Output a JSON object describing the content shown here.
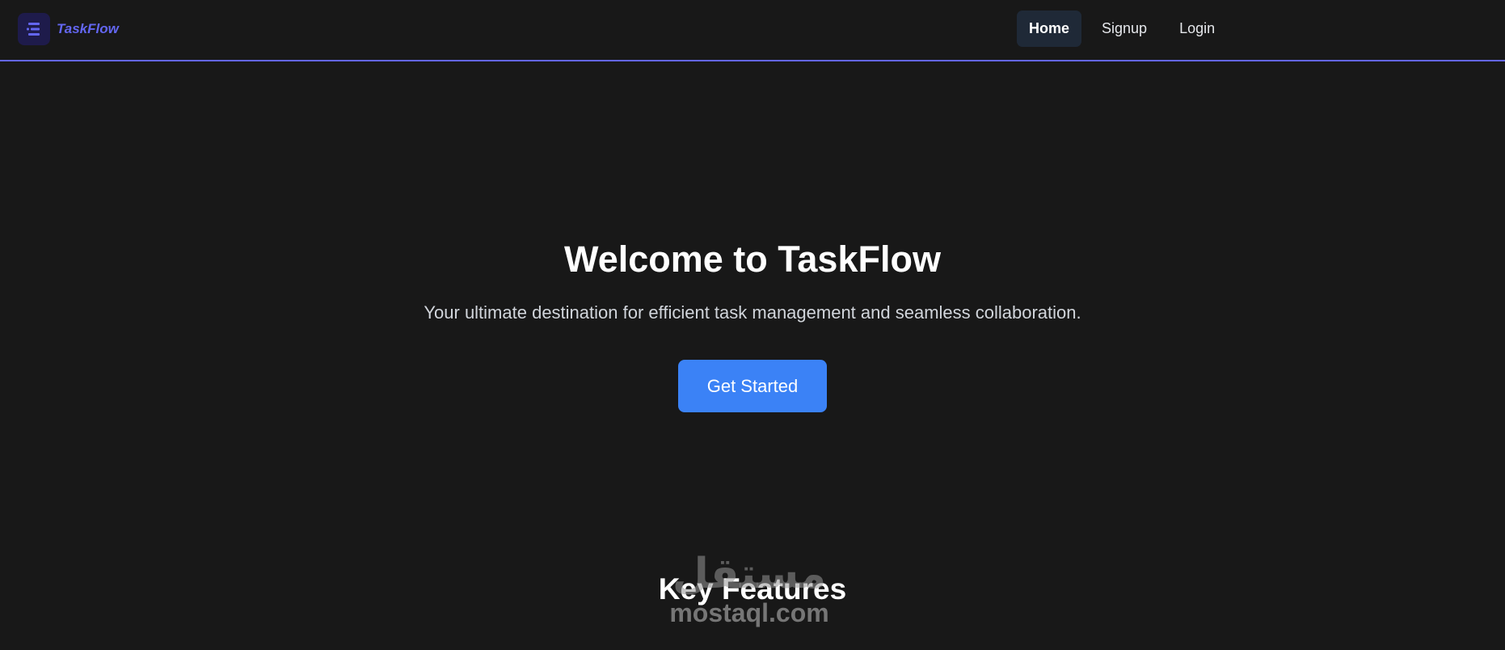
{
  "header": {
    "brand_name": "TaskFlow",
    "logo_icon": "list-icon",
    "nav": [
      {
        "label": "Home",
        "active": true
      },
      {
        "label": "Signup",
        "active": false
      },
      {
        "label": "Login",
        "active": false
      }
    ]
  },
  "hero": {
    "title": "Welcome to TaskFlow",
    "subtitle": "Your ultimate destination for efficient task management and seamless collaboration.",
    "cta_label": "Get Started"
  },
  "features": {
    "title": "Key Features"
  },
  "watermark": {
    "arabic": "مستقل",
    "latin": "mostaql.com"
  },
  "colors": {
    "background": "#181818",
    "accent": "#6366f1",
    "cta": "#3b82f6",
    "active_nav_bg": "#1f2937"
  }
}
